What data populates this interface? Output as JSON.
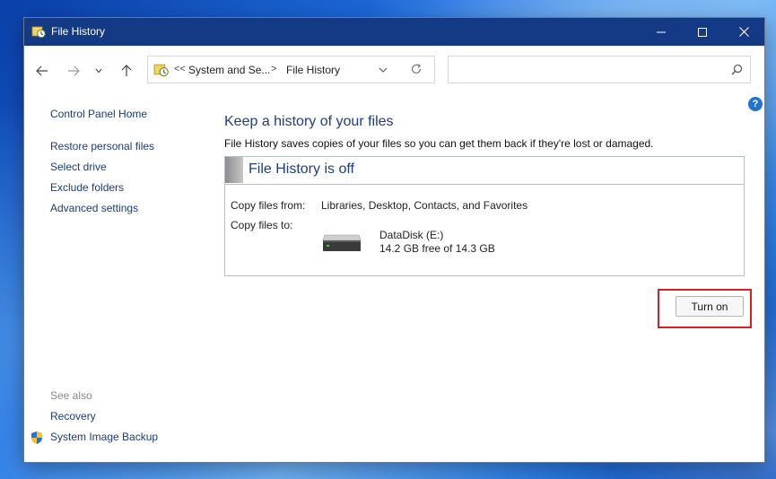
{
  "window": {
    "title": "File History",
    "titlebar_color": "#143a86"
  },
  "navigation": {
    "back_icon": "arrow-left-icon",
    "forward_icon": "arrow-right-icon",
    "recent_icon": "chevron-down-icon",
    "up_icon": "arrow-up-icon"
  },
  "address_bar": {
    "overflow_marker": "<<",
    "crumbs": [
      "System and Se...",
      "File History"
    ],
    "separator": ">",
    "refresh_icon": "refresh-icon"
  },
  "search": {
    "value": "",
    "placeholder": "",
    "icon": "search-icon"
  },
  "help": {
    "label": "?"
  },
  "sidebar": {
    "home_link": "Control Panel Home",
    "links": [
      "Restore personal files",
      "Select drive",
      "Exclude folders",
      "Advanced settings"
    ],
    "see_also_label": "See also",
    "see_also_links": [
      "Recovery",
      "System Image Backup"
    ]
  },
  "main": {
    "heading": "Keep a history of your files",
    "description": "File History saves copies of your files so you can get them back if they're lost or damaged.",
    "status": {
      "title": "File History is off",
      "copy_from_label": "Copy files from:",
      "copy_from_value": "Libraries, Desktop, Contacts, and Favorites",
      "copy_to_label": "Copy files to:",
      "drive_name": "DataDisk (E:)",
      "drive_space": "14.2 GB free of 14.3 GB"
    },
    "turn_on_label": "Turn on",
    "highlight_color": "#d42027",
    "link_color": "#1a3b7a",
    "heading_color": "#1f3d80"
  }
}
